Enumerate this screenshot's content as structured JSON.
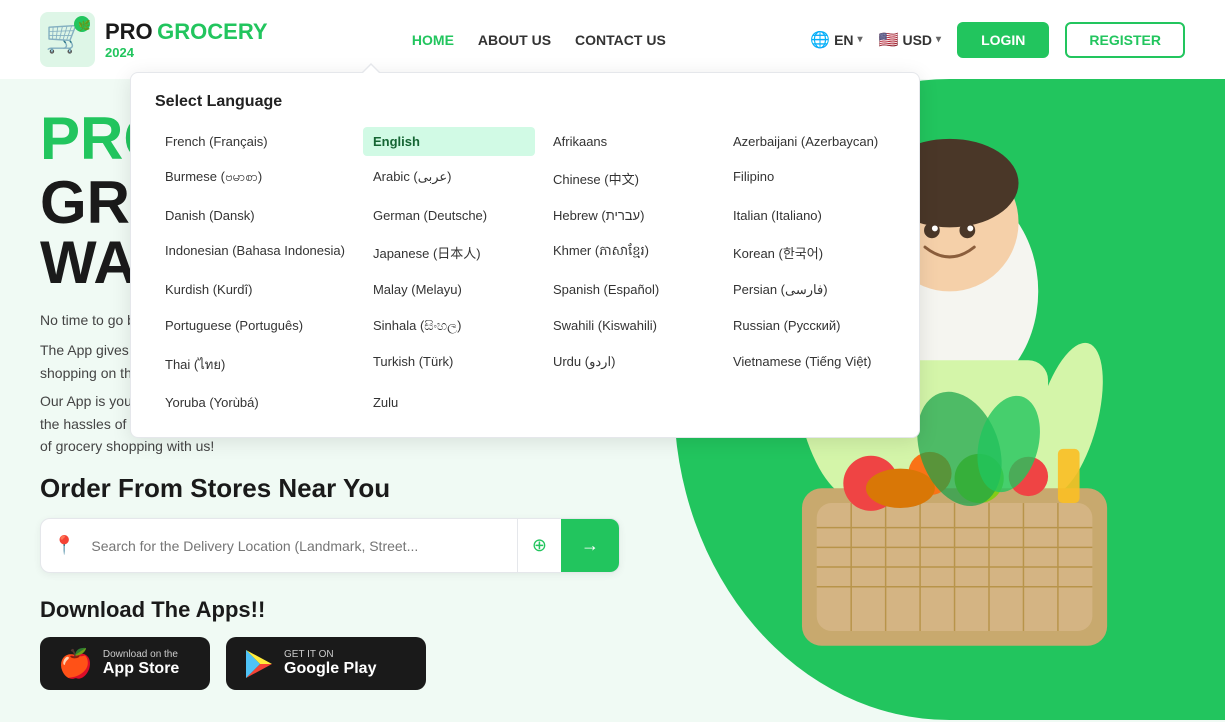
{
  "header": {
    "logo": {
      "pro": "PRO",
      "grocery": "GROCERY",
      "year": "2024"
    },
    "nav": {
      "home": "HOME",
      "about": "ABOUT US",
      "contact": "CONTACT US"
    },
    "lang": {
      "globe": "🌐",
      "code": "EN",
      "flag": "🇺🇸",
      "currency_flag": "🇺🇸",
      "currency": "USD"
    },
    "buttons": {
      "login": "LOGIN",
      "register": "REGISTER"
    }
  },
  "language_dropdown": {
    "title": "Select Language",
    "languages": [
      {
        "label": "French (Français)",
        "selected": false
      },
      {
        "label": "English",
        "selected": true
      },
      {
        "label": "Afrikaans",
        "selected": false
      },
      {
        "label": "Azerbaijani (Azerbaycan)",
        "selected": false
      },
      {
        "label": "Burmese (ဗမာစာ)",
        "selected": false
      },
      {
        "label": "Arabic (عربى)",
        "selected": false
      },
      {
        "label": "Chinese (中文)",
        "selected": false
      },
      {
        "label": "Filipino",
        "selected": false
      },
      {
        "label": "Danish (Dansk)",
        "selected": false
      },
      {
        "label": "German (Deutsche)",
        "selected": false
      },
      {
        "label": "Hebrew (עברית)",
        "selected": false
      },
      {
        "label": "Italian (Italiano)",
        "selected": false
      },
      {
        "label": "Indonesian (Bahasa Indonesia)",
        "selected": false
      },
      {
        "label": "Japanese (日本人)",
        "selected": false
      },
      {
        "label": "Khmer (ភាសាខ្មែរ)",
        "selected": false
      },
      {
        "label": "Korean (한국어)",
        "selected": false
      },
      {
        "label": "Kurdish (Kurdî)",
        "selected": false
      },
      {
        "label": "Malay (Melayu)",
        "selected": false
      },
      {
        "label": "Spanish (Español)",
        "selected": false
      },
      {
        "label": "Persian (فارسی)",
        "selected": false
      },
      {
        "label": "Portuguese (Português)",
        "selected": false
      },
      {
        "label": "Sinhala (සිංහල)",
        "selected": false
      },
      {
        "label": "Swahili (Kiswahili)",
        "selected": false
      },
      {
        "label": "Russian (Русский)",
        "selected": false
      },
      {
        "label": "Thai (ไทย)",
        "selected": false
      },
      {
        "label": "Turkish (Türk)",
        "selected": false
      },
      {
        "label": "Urdu (اردو)",
        "selected": false
      },
      {
        "label": "Vietnamese (Tiếng Việt)",
        "selected": false
      },
      {
        "label": "Yoruba (Yorùbá)",
        "selected": false
      },
      {
        "label": "Zulu",
        "selected": false
      }
    ]
  },
  "hero": {
    "title_line1": "PROG",
    "title_line2": "GROCERY",
    "title_line3": "WAY",
    "desc1": "No time to go b… get Groceries d…",
    "desc2_full": "The App gives you time back because life can be busy, so do your grocery shopping on the weekend. Pick up your stuff from our friendly drivers",
    "desc3": "Our App is your ultimate solution for modern grocery shopping. Say goodbye to the hassles of crowded stores, long lines, and heavy bags. Embrace a new era of grocery shopping with us!",
    "order_title": "Order From Stores Near You",
    "search_placeholder": "Search for the Delivery Location (Landmark, Street...",
    "apps_title": "Download The Apps!!",
    "app_store": {
      "small": "Download on the",
      "big": "App Store"
    },
    "google_play": {
      "small": "GET IT ON",
      "big": "Google Play"
    }
  }
}
